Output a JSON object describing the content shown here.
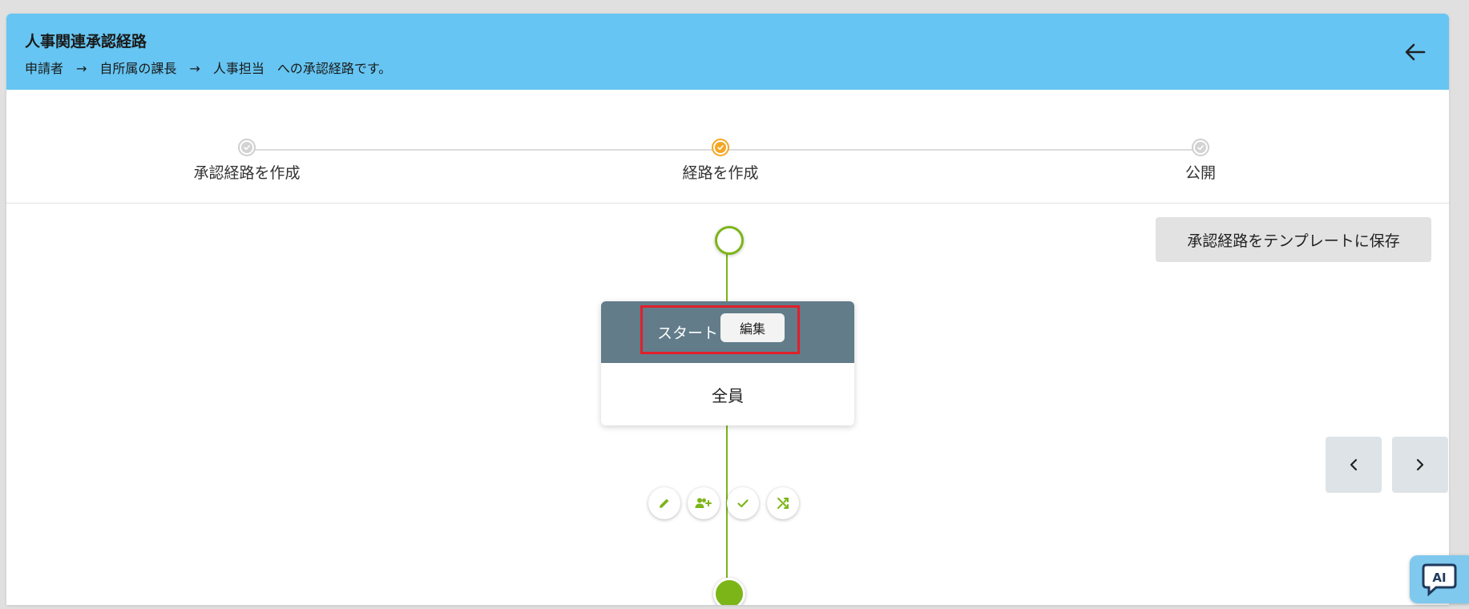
{
  "header": {
    "title": "人事関連承認経路",
    "subtitle": "申請者　→　自所属の課長　→　人事担当　への承認経路です。",
    "back_icon": "arrow-left-icon"
  },
  "stepper": {
    "steps": [
      {
        "label": "承認経路を作成",
        "state": "done"
      },
      {
        "label": "経路を作成",
        "state": "active"
      },
      {
        "label": "公開",
        "state": "pending"
      }
    ]
  },
  "toolbar": {
    "save_template_label": "承認経路をテンプレートに保存"
  },
  "flow": {
    "start_node": {
      "header_label": "スタート",
      "edit_label": "編集",
      "body_text": "全員"
    },
    "actions": [
      "pencil-icon",
      "person-add-icon",
      "check-icon",
      "shuffle-icon"
    ]
  },
  "nav": {
    "prev_icon": "chevron-left-icon",
    "next_icon": "chevron-right-icon"
  },
  "ai_assistant": {
    "label": "AI"
  },
  "colors": {
    "header_bg": "#66c5f2",
    "accent_green": "#7cb518",
    "active_step": "#f5a623",
    "node_header": "#627c8a",
    "highlight_border": "#e0202a"
  }
}
